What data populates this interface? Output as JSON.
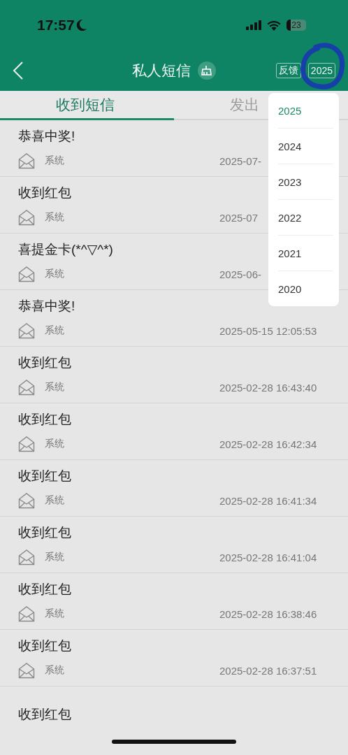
{
  "status_bar": {
    "time": "17:57",
    "battery": "23"
  },
  "header": {
    "title": "私人短信",
    "feedback": "反馈",
    "year": "2025"
  },
  "tabs": [
    {
      "label": "收到短信",
      "selected": true
    },
    {
      "label": "发出",
      "selected": false
    }
  ],
  "messages": [
    {
      "title": "恭喜中奖!",
      "sender": "系统",
      "time": "2025-07-"
    },
    {
      "title": "收到红包",
      "sender": "系统",
      "time": "2025-07"
    },
    {
      "title": "喜提金卡(*^▽^*)",
      "sender": "系统",
      "time": "2025-06-"
    },
    {
      "title": "恭喜中奖!",
      "sender": "系统",
      "time": "2025-05-15 12:05:53"
    },
    {
      "title": "收到红包",
      "sender": "系统",
      "time": "2025-02-28 16:43:40"
    },
    {
      "title": "收到红包",
      "sender": "系统",
      "time": "2025-02-28 16:42:34"
    },
    {
      "title": "收到红包",
      "sender": "系统",
      "time": "2025-02-28 16:41:34"
    },
    {
      "title": "收到红包",
      "sender": "系统",
      "time": "2025-02-28 16:41:04"
    },
    {
      "title": "收到红包",
      "sender": "系统",
      "time": "2025-02-28 16:38:46"
    },
    {
      "title": "收到红包",
      "sender": "系统",
      "time": "2025-02-28 16:37:51"
    },
    {
      "title": "收到红包"
    }
  ],
  "year_menu": [
    {
      "label": "2025",
      "selected": true
    },
    {
      "label": "2024",
      "selected": false
    },
    {
      "label": "2023",
      "selected": false
    },
    {
      "label": "2022",
      "selected": false
    },
    {
      "label": "2021",
      "selected": false
    },
    {
      "label": "2020",
      "selected": false
    }
  ]
}
